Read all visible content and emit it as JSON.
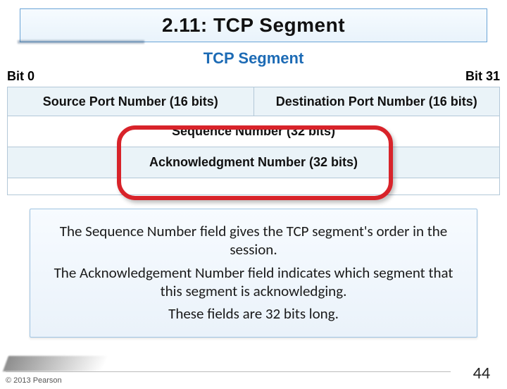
{
  "title": "2.11: TCP Segment",
  "subtitle": "TCP Segment",
  "bits": {
    "left": "Bit 0",
    "right": "Bit 31"
  },
  "segment": {
    "src_port": "Source Port Number (16 bits)",
    "dst_port": "Destination Port Number (16 bits)",
    "seq": "Sequence Number (32 bits)",
    "ack": "Acknowledgment Number (32 bits)"
  },
  "info": {
    "p1": "The Sequence Number field gives the TCP segment's order in the session.",
    "p2": "The Acknowledgement Number field indicates which segment that this segment is acknowledging.",
    "p3": "These fields are 32 bits long."
  },
  "copyright": "© 2013 Pearson",
  "page": "44"
}
